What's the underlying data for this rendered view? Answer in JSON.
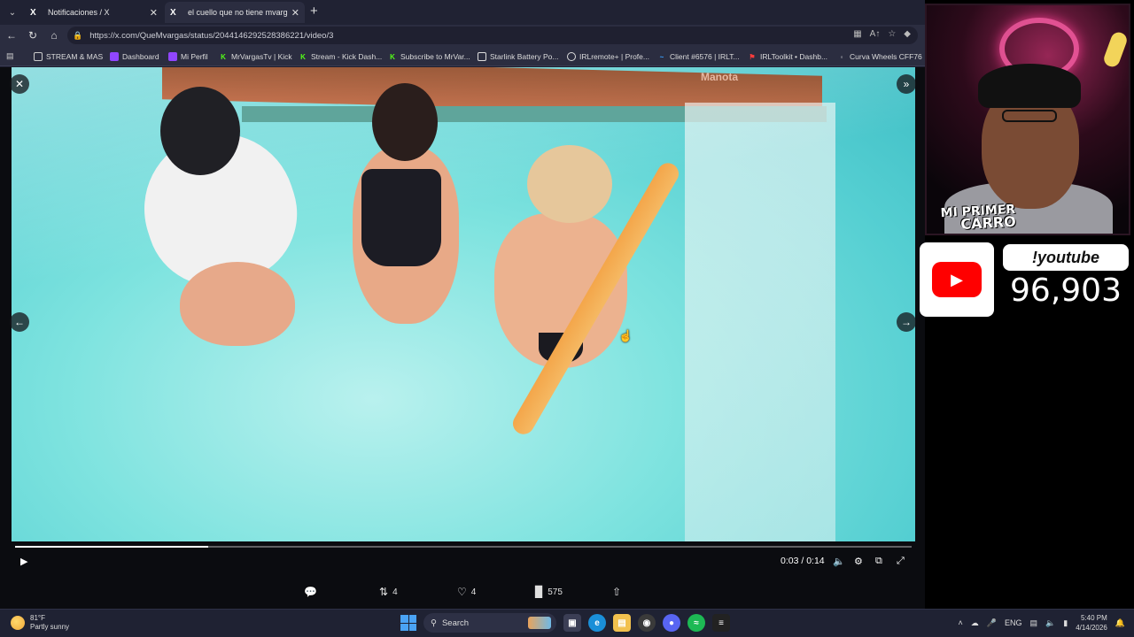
{
  "browser": {
    "tabs": [
      {
        "icon": "X",
        "title": "Notificaciones / X"
      },
      {
        "icon": "X",
        "title": "el cuello que no tiene mvargas en"
      }
    ],
    "url": "https://x.com/QueMvargas/status/2044146292528386221/video/3",
    "bookmarks": [
      {
        "label": "STREAM & MAS",
        "color": "#d9d9d9"
      },
      {
        "label": "Dashboard",
        "color": "#9146ff"
      },
      {
        "label": "Mi Perfil",
        "color": "#9146ff"
      },
      {
        "label": "MrVargasTv | Kick",
        "color": "#53fc18"
      },
      {
        "label": "Stream - Kick Dash...",
        "color": "#53fc18"
      },
      {
        "label": "Subscribe to MrVar...",
        "color": "#53fc18"
      },
      {
        "label": "Starlink Battery Po...",
        "color": "#e6e6e6"
      },
      {
        "label": "IRLremote+ | Profe...",
        "color": "#e6e6e6"
      },
      {
        "label": "Client #6576 | IRLT...",
        "color": "#3aa0ff"
      },
      {
        "label": "IRLToolkit • Dashb...",
        "color": "#ff3b3b"
      },
      {
        "label": "Curva Wheels CFF76",
        "color": "#e6e6e6"
      }
    ]
  },
  "media": {
    "watermark": "Manota",
    "time": "0:03 / 0:14",
    "progress": 0.215
  },
  "tweet": {
    "reply_count": "",
    "retweet_count": "4",
    "like_count": "4",
    "view_count": "575"
  },
  "taskbar": {
    "temperature": "81°F",
    "weather": "Partly sunny",
    "search_label": "Search",
    "language": "ENG",
    "time": "5:40 PM",
    "date": "4/14/2026"
  },
  "overlay": {
    "cam_label_line1": "MI PRIMER",
    "cam_label_line2": "CARRO",
    "youtube_command": "!youtube",
    "youtube_count": "96,903"
  },
  "colors": {
    "youtube_red": "#ff0000",
    "neon_pink": "#ff5fa8",
    "windows_blue": "#4aa3f5"
  }
}
